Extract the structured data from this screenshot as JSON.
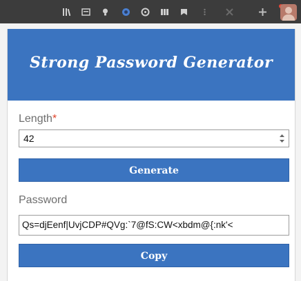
{
  "app": {
    "title": "Strong Password Generator"
  },
  "toolbar": {
    "icons": [
      "library-icon",
      "reader-view-icon",
      "lightbulb-icon",
      "extension-blue-icon",
      "circle-icon",
      "grid-icon",
      "bookmark-icon",
      "dots-icon",
      "cross-icon",
      "profile-avatar"
    ]
  },
  "form": {
    "length_label": "Length",
    "required_marker": "*",
    "length_value": "42",
    "generate_label": "Generate",
    "password_label": "Password",
    "password_value": "Qs=djEenf|UvjCDP#QVg:`7@fS:CW<xbdm@{:nk'<",
    "copy_label": "Copy"
  },
  "colors": {
    "accent": "#3b74c0",
    "required": "#e0442a",
    "toolbar": "#3c3c3c"
  }
}
